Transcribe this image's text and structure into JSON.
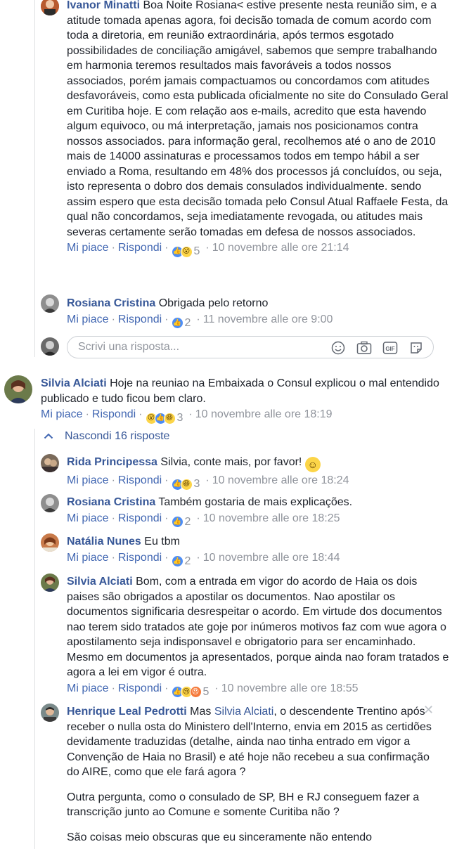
{
  "comments": {
    "c1": {
      "author": "Ivanor Minatti",
      "text": "Boa Noite Rosiana< estive presente nesta reunião sim, e a atitude tomada apenas agora, foi decisão tomada de comum acordo com toda a diretoria, em reunião extraordinária, após termos esgotado possibilidades de conciliação amigável, sabemos que sempre trabalhando em harmonia teremos resultados mais favoráveis a todos nossos associados, porém jamais compactuamos ou concordamos com atitudes desfavoráveis, como esta publicada oficialmente no site do Consulado Geral em Curitiba hoje. E com relação aos e-mails, acredito que esta havendo algum equivoco, ou má interpretação, jamais nos posicionamos contra nossos associados. para informação geral, recolhemos até o ano de 2010 mais de 14000 assinaturas e processamos todos em tempo hábil a ser enviado a Roma, resultando em 48% dos processos já concluídos, ou seja, isto representa o dobro dos demais consulados individualmente. sendo assim espero que esta decisão tomada pelo Consul Atual Raffaele Festa, da qual não concordamos, seja imediatamente revogada, ou atitudes mais severas certamente serão tomadas em defesa de nossos associados.",
      "like": "Mi piace",
      "reply": "Rispondi",
      "count": "5",
      "time": "10 novembre alle ore 21:14"
    },
    "c2": {
      "author": "Rosiana Cristina",
      "text": "Obrigada pelo retorno",
      "like": "Mi piace",
      "reply": "Rispondi",
      "count": "2",
      "time": "11 novembre alle ore 9:00"
    },
    "reply_box": {
      "placeholder": "Scrivi una risposta..."
    },
    "c3": {
      "author": "Silvia Alciati",
      "text": "Hoje na reuniao na Embaixada o Consul explicou o mal entendido publicado e tudo ficou bem claro.",
      "like": "Mi piace",
      "reply": "Rispondi",
      "count": "3",
      "time": "10 novembre alle ore 18:19"
    },
    "hide_replies": "Nascondi 16 risposte",
    "c4": {
      "author": "Rida Principessa",
      "text": "Silvia, conte mais, por favor!",
      "like": "Mi piace",
      "reply": "Rispondi",
      "count": "3",
      "time": "10 novembre alle ore 18:24"
    },
    "c5": {
      "author": "Rosiana Cristina",
      "text": "Também gostaria de mais explicações.",
      "like": "Mi piace",
      "reply": "Rispondi",
      "count": "2",
      "time": "10 novembre alle ore 18:25"
    },
    "c6": {
      "author": "Natália Nunes",
      "text": "Eu tbm",
      "like": "Mi piace",
      "reply": "Rispondi",
      "count": "2",
      "time": "10 novembre alle ore 18:44"
    },
    "c7": {
      "author": "Silvia Alciati",
      "text": "Bom, com a entrada em vigor do acordo de Haia os dois paises são obrigados a apostilar os documentos. Nao apostilar os documentos significaria desrespeitar o acordo. Em virtude dos documentos nao terem sido tratados ate goje por inúmeros motivos faz com wue agora o apostilamento seja indisponsavel e obrigatorio para ser encaminhado. Mesmo em documentos ja apresentados, porque ainda nao foram tratados e agora a lei em vigor é outra.",
      "like": "Mi piace",
      "reply": "Rispondi",
      "count": "5",
      "time": "10 novembre alle ore 18:55"
    },
    "c8": {
      "author": "Henrique Leal Pedrotti",
      "prefix": "Mas",
      "mention": "Silvia Alciati",
      "text": ", o descendente Trentino após receber o nulla osta do Ministero dell'Interno, envia em 2015 as certidões devidamente traduzidas (detalhe, ainda nao tinha entrado em vigor a Convenção de Haia no Brasil) e até hoje não recebeu a sua confirmação do AIRE, como que ele fará agora ?",
      "para2": "Outra pergunta, como o consulado de SP, BH e RJ conseguem fazer a transcrição junto ao Comune e somente Curitiba não ?",
      "para3": "São coisas meio obscuras que eu sinceramente não entendo"
    }
  },
  "icons": {
    "separator": "·",
    "close": "✕",
    "chevron": "⌃"
  },
  "colors": {
    "link": "#385898",
    "meta": "#90949c",
    "like_blue": "#4c8df6"
  }
}
